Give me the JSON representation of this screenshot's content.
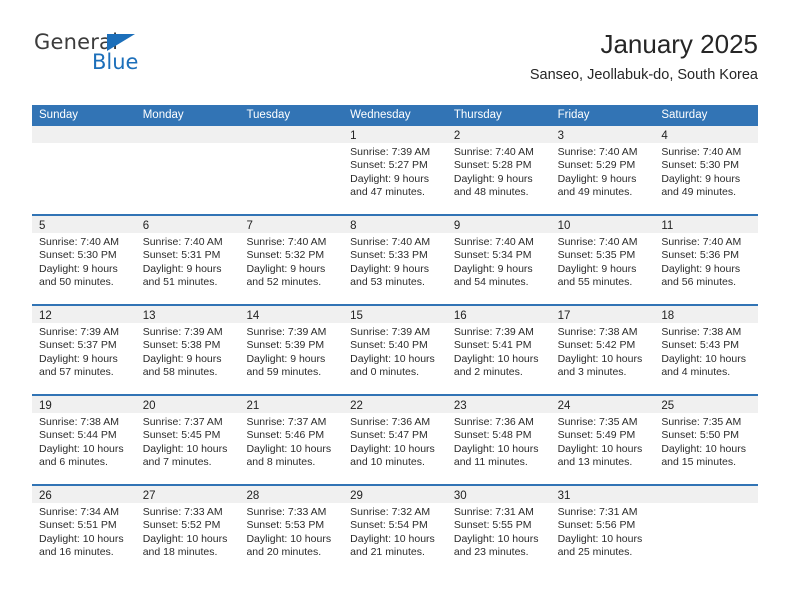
{
  "brand": {
    "name_primary": "General",
    "name_secondary": "Blue",
    "logo_icon": "triangle-flag-icon"
  },
  "header": {
    "title": "January 2025",
    "subtitle": "Sanseo, Jeollabuk-do, South Korea"
  },
  "colors": {
    "header_blue": "#3274b5",
    "brand_blue": "#1c6fba",
    "daynum_band": "#f0f0f0",
    "text": "#2b2b2b"
  },
  "weekdays": [
    "Sunday",
    "Monday",
    "Tuesday",
    "Wednesday",
    "Thursday",
    "Friday",
    "Saturday"
  ],
  "weeks": [
    [
      {
        "day": "",
        "lines": []
      },
      {
        "day": "",
        "lines": []
      },
      {
        "day": "",
        "lines": []
      },
      {
        "day": "1",
        "lines": [
          "Sunrise: 7:39 AM",
          "Sunset: 5:27 PM",
          "Daylight: 9 hours",
          "and 47 minutes."
        ]
      },
      {
        "day": "2",
        "lines": [
          "Sunrise: 7:40 AM",
          "Sunset: 5:28 PM",
          "Daylight: 9 hours",
          "and 48 minutes."
        ]
      },
      {
        "day": "3",
        "lines": [
          "Sunrise: 7:40 AM",
          "Sunset: 5:29 PM",
          "Daylight: 9 hours",
          "and 49 minutes."
        ]
      },
      {
        "day": "4",
        "lines": [
          "Sunrise: 7:40 AM",
          "Sunset: 5:30 PM",
          "Daylight: 9 hours",
          "and 49 minutes."
        ]
      }
    ],
    [
      {
        "day": "5",
        "lines": [
          "Sunrise: 7:40 AM",
          "Sunset: 5:30 PM",
          "Daylight: 9 hours",
          "and 50 minutes."
        ]
      },
      {
        "day": "6",
        "lines": [
          "Sunrise: 7:40 AM",
          "Sunset: 5:31 PM",
          "Daylight: 9 hours",
          "and 51 minutes."
        ]
      },
      {
        "day": "7",
        "lines": [
          "Sunrise: 7:40 AM",
          "Sunset: 5:32 PM",
          "Daylight: 9 hours",
          "and 52 minutes."
        ]
      },
      {
        "day": "8",
        "lines": [
          "Sunrise: 7:40 AM",
          "Sunset: 5:33 PM",
          "Daylight: 9 hours",
          "and 53 minutes."
        ]
      },
      {
        "day": "9",
        "lines": [
          "Sunrise: 7:40 AM",
          "Sunset: 5:34 PM",
          "Daylight: 9 hours",
          "and 54 minutes."
        ]
      },
      {
        "day": "10",
        "lines": [
          "Sunrise: 7:40 AM",
          "Sunset: 5:35 PM",
          "Daylight: 9 hours",
          "and 55 minutes."
        ]
      },
      {
        "day": "11",
        "lines": [
          "Sunrise: 7:40 AM",
          "Sunset: 5:36 PM",
          "Daylight: 9 hours",
          "and 56 minutes."
        ]
      }
    ],
    [
      {
        "day": "12",
        "lines": [
          "Sunrise: 7:39 AM",
          "Sunset: 5:37 PM",
          "Daylight: 9 hours",
          "and 57 minutes."
        ]
      },
      {
        "day": "13",
        "lines": [
          "Sunrise: 7:39 AM",
          "Sunset: 5:38 PM",
          "Daylight: 9 hours",
          "and 58 minutes."
        ]
      },
      {
        "day": "14",
        "lines": [
          "Sunrise: 7:39 AM",
          "Sunset: 5:39 PM",
          "Daylight: 9 hours",
          "and 59 minutes."
        ]
      },
      {
        "day": "15",
        "lines": [
          "Sunrise: 7:39 AM",
          "Sunset: 5:40 PM",
          "Daylight: 10 hours",
          "and 0 minutes."
        ]
      },
      {
        "day": "16",
        "lines": [
          "Sunrise: 7:39 AM",
          "Sunset: 5:41 PM",
          "Daylight: 10 hours",
          "and 2 minutes."
        ]
      },
      {
        "day": "17",
        "lines": [
          "Sunrise: 7:38 AM",
          "Sunset: 5:42 PM",
          "Daylight: 10 hours",
          "and 3 minutes."
        ]
      },
      {
        "day": "18",
        "lines": [
          "Sunrise: 7:38 AM",
          "Sunset: 5:43 PM",
          "Daylight: 10 hours",
          "and 4 minutes."
        ]
      }
    ],
    [
      {
        "day": "19",
        "lines": [
          "Sunrise: 7:38 AM",
          "Sunset: 5:44 PM",
          "Daylight: 10 hours",
          "and 6 minutes."
        ]
      },
      {
        "day": "20",
        "lines": [
          "Sunrise: 7:37 AM",
          "Sunset: 5:45 PM",
          "Daylight: 10 hours",
          "and 7 minutes."
        ]
      },
      {
        "day": "21",
        "lines": [
          "Sunrise: 7:37 AM",
          "Sunset: 5:46 PM",
          "Daylight: 10 hours",
          "and 8 minutes."
        ]
      },
      {
        "day": "22",
        "lines": [
          "Sunrise: 7:36 AM",
          "Sunset: 5:47 PM",
          "Daylight: 10 hours",
          "and 10 minutes."
        ]
      },
      {
        "day": "23",
        "lines": [
          "Sunrise: 7:36 AM",
          "Sunset: 5:48 PM",
          "Daylight: 10 hours",
          "and 11 minutes."
        ]
      },
      {
        "day": "24",
        "lines": [
          "Sunrise: 7:35 AM",
          "Sunset: 5:49 PM",
          "Daylight: 10 hours",
          "and 13 minutes."
        ]
      },
      {
        "day": "25",
        "lines": [
          "Sunrise: 7:35 AM",
          "Sunset: 5:50 PM",
          "Daylight: 10 hours",
          "and 15 minutes."
        ]
      }
    ],
    [
      {
        "day": "26",
        "lines": [
          "Sunrise: 7:34 AM",
          "Sunset: 5:51 PM",
          "Daylight: 10 hours",
          "and 16 minutes."
        ]
      },
      {
        "day": "27",
        "lines": [
          "Sunrise: 7:33 AM",
          "Sunset: 5:52 PM",
          "Daylight: 10 hours",
          "and 18 minutes."
        ]
      },
      {
        "day": "28",
        "lines": [
          "Sunrise: 7:33 AM",
          "Sunset: 5:53 PM",
          "Daylight: 10 hours",
          "and 20 minutes."
        ]
      },
      {
        "day": "29",
        "lines": [
          "Sunrise: 7:32 AM",
          "Sunset: 5:54 PM",
          "Daylight: 10 hours",
          "and 21 minutes."
        ]
      },
      {
        "day": "30",
        "lines": [
          "Sunrise: 7:31 AM",
          "Sunset: 5:55 PM",
          "Daylight: 10 hours",
          "and 23 minutes."
        ]
      },
      {
        "day": "31",
        "lines": [
          "Sunrise: 7:31 AM",
          "Sunset: 5:56 PM",
          "Daylight: 10 hours",
          "and 25 minutes."
        ]
      },
      {
        "day": "",
        "lines": []
      }
    ]
  ]
}
